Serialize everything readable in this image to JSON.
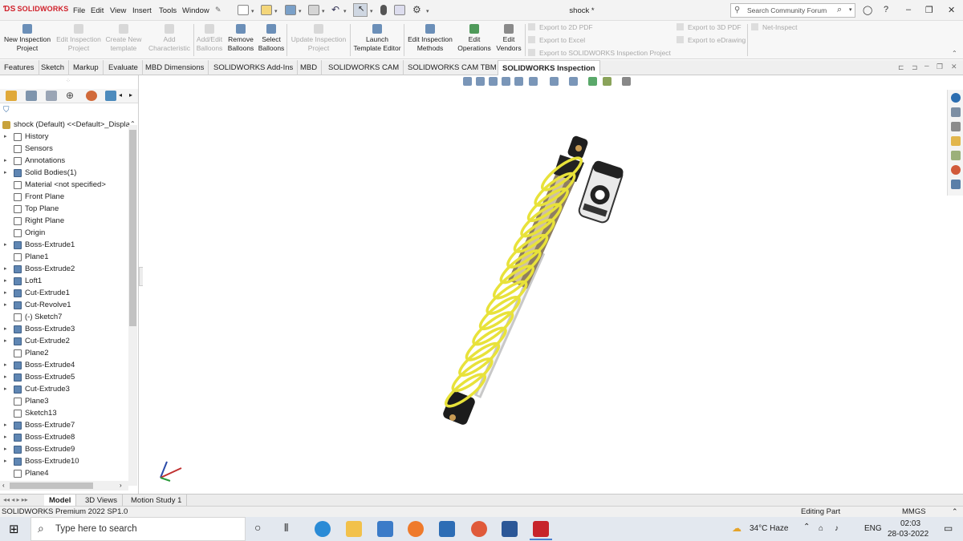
{
  "app": {
    "logo_text": "SOLIDWORKS",
    "document_title": "shock *",
    "search_placeholder": "Search Community Forum",
    "menus": [
      "File",
      "Edit",
      "View",
      "Insert",
      "Tools",
      "Window"
    ]
  },
  "command_manager": {
    "buttons": [
      {
        "label1": "New Inspection",
        "label2": "Project",
        "enabled": true
      },
      {
        "label1": "Edit Inspection",
        "label2": "Project",
        "enabled": false
      },
      {
        "label1": "Create New",
        "label2": "template",
        "enabled": false
      },
      {
        "label1": "Add",
        "label2": "Characteristic",
        "enabled": false
      },
      {
        "label1": "Add/Edit",
        "label2": "Balloons",
        "enabled": false
      },
      {
        "label1": "Remove",
        "label2": "Balloons",
        "enabled": true
      },
      {
        "label1": "Select",
        "label2": "Balloons",
        "enabled": true
      },
      {
        "label1": "Update Inspection",
        "label2": "Project",
        "enabled": false
      },
      {
        "label1": "Launch",
        "label2": "Template Editor",
        "enabled": true
      },
      {
        "label1": "Edit Inspection",
        "label2": "Methods",
        "enabled": true
      },
      {
        "label1": "Edit",
        "label2": "Operations",
        "enabled": true
      },
      {
        "label1": "Edit",
        "label2": "Vendors",
        "enabled": true
      }
    ],
    "exports": [
      "Export to 2D PDF",
      "Export to Excel",
      "Export to SOLIDWORKS Inspection Project",
      "Export to 3D PDF",
      "Export to eDrawing",
      "Net-Inspect"
    ]
  },
  "tabs": [
    "Features",
    "Sketch",
    "Markup",
    "Evaluate",
    "MBD Dimensions",
    "SOLIDWORKS Add-Ins",
    "MBD",
    "SOLIDWORKS CAM",
    "SOLIDWORKS CAM TBM",
    "SOLIDWORKS Inspection"
  ],
  "active_tab": "SOLIDWORKS Inspection",
  "feature_tree": {
    "root": "shock (Default) <<Default>_Displa",
    "items": [
      {
        "label": "History",
        "arrow": true
      },
      {
        "label": "Sensors",
        "arrow": false
      },
      {
        "label": "Annotations",
        "arrow": true
      },
      {
        "label": "Solid Bodies(1)",
        "arrow": true
      },
      {
        "label": "Material <not specified>",
        "arrow": false
      },
      {
        "label": "Front Plane",
        "arrow": false
      },
      {
        "label": "Top Plane",
        "arrow": false
      },
      {
        "label": "Right Plane",
        "arrow": false
      },
      {
        "label": "Origin",
        "arrow": false
      },
      {
        "label": "Boss-Extrude1",
        "arrow": true
      },
      {
        "label": "Plane1",
        "arrow": false
      },
      {
        "label": "Boss-Extrude2",
        "arrow": true
      },
      {
        "label": "Loft1",
        "arrow": true
      },
      {
        "label": "Cut-Extrude1",
        "arrow": true
      },
      {
        "label": "Cut-Revolve1",
        "arrow": true
      },
      {
        "label": "(-) Sketch7",
        "arrow": false
      },
      {
        "label": "Boss-Extrude3",
        "arrow": true
      },
      {
        "label": "Cut-Extrude2",
        "arrow": true
      },
      {
        "label": "Plane2",
        "arrow": false
      },
      {
        "label": "Boss-Extrude4",
        "arrow": true
      },
      {
        "label": "Boss-Extrude5",
        "arrow": true
      },
      {
        "label": "Cut-Extrude3",
        "arrow": true
      },
      {
        "label": "Plane3",
        "arrow": false
      },
      {
        "label": "Sketch13",
        "arrow": false
      },
      {
        "label": "Boss-Extrude7",
        "arrow": true
      },
      {
        "label": "Boss-Extrude8",
        "arrow": true
      },
      {
        "label": "Boss-Extrude9",
        "arrow": true
      },
      {
        "label": "Boss-Extrude10",
        "arrow": true
      },
      {
        "label": "Plane4",
        "arrow": false
      }
    ]
  },
  "bottom_tabs": [
    "Model",
    "3D Views",
    "Motion Study 1"
  ],
  "status": {
    "version": "SOLIDWORKS Premium 2022 SP1.0",
    "mode": "Editing Part",
    "units": "MMGS"
  },
  "taskbar": {
    "search_placeholder": "Type here to search",
    "weather": "34°C  Haze",
    "language": "ENG",
    "time": "02:03",
    "date": "28-03-2022"
  },
  "colors": {
    "brand": "#d0202a",
    "spring": "#e8e23a",
    "body": "#b9a78a"
  }
}
